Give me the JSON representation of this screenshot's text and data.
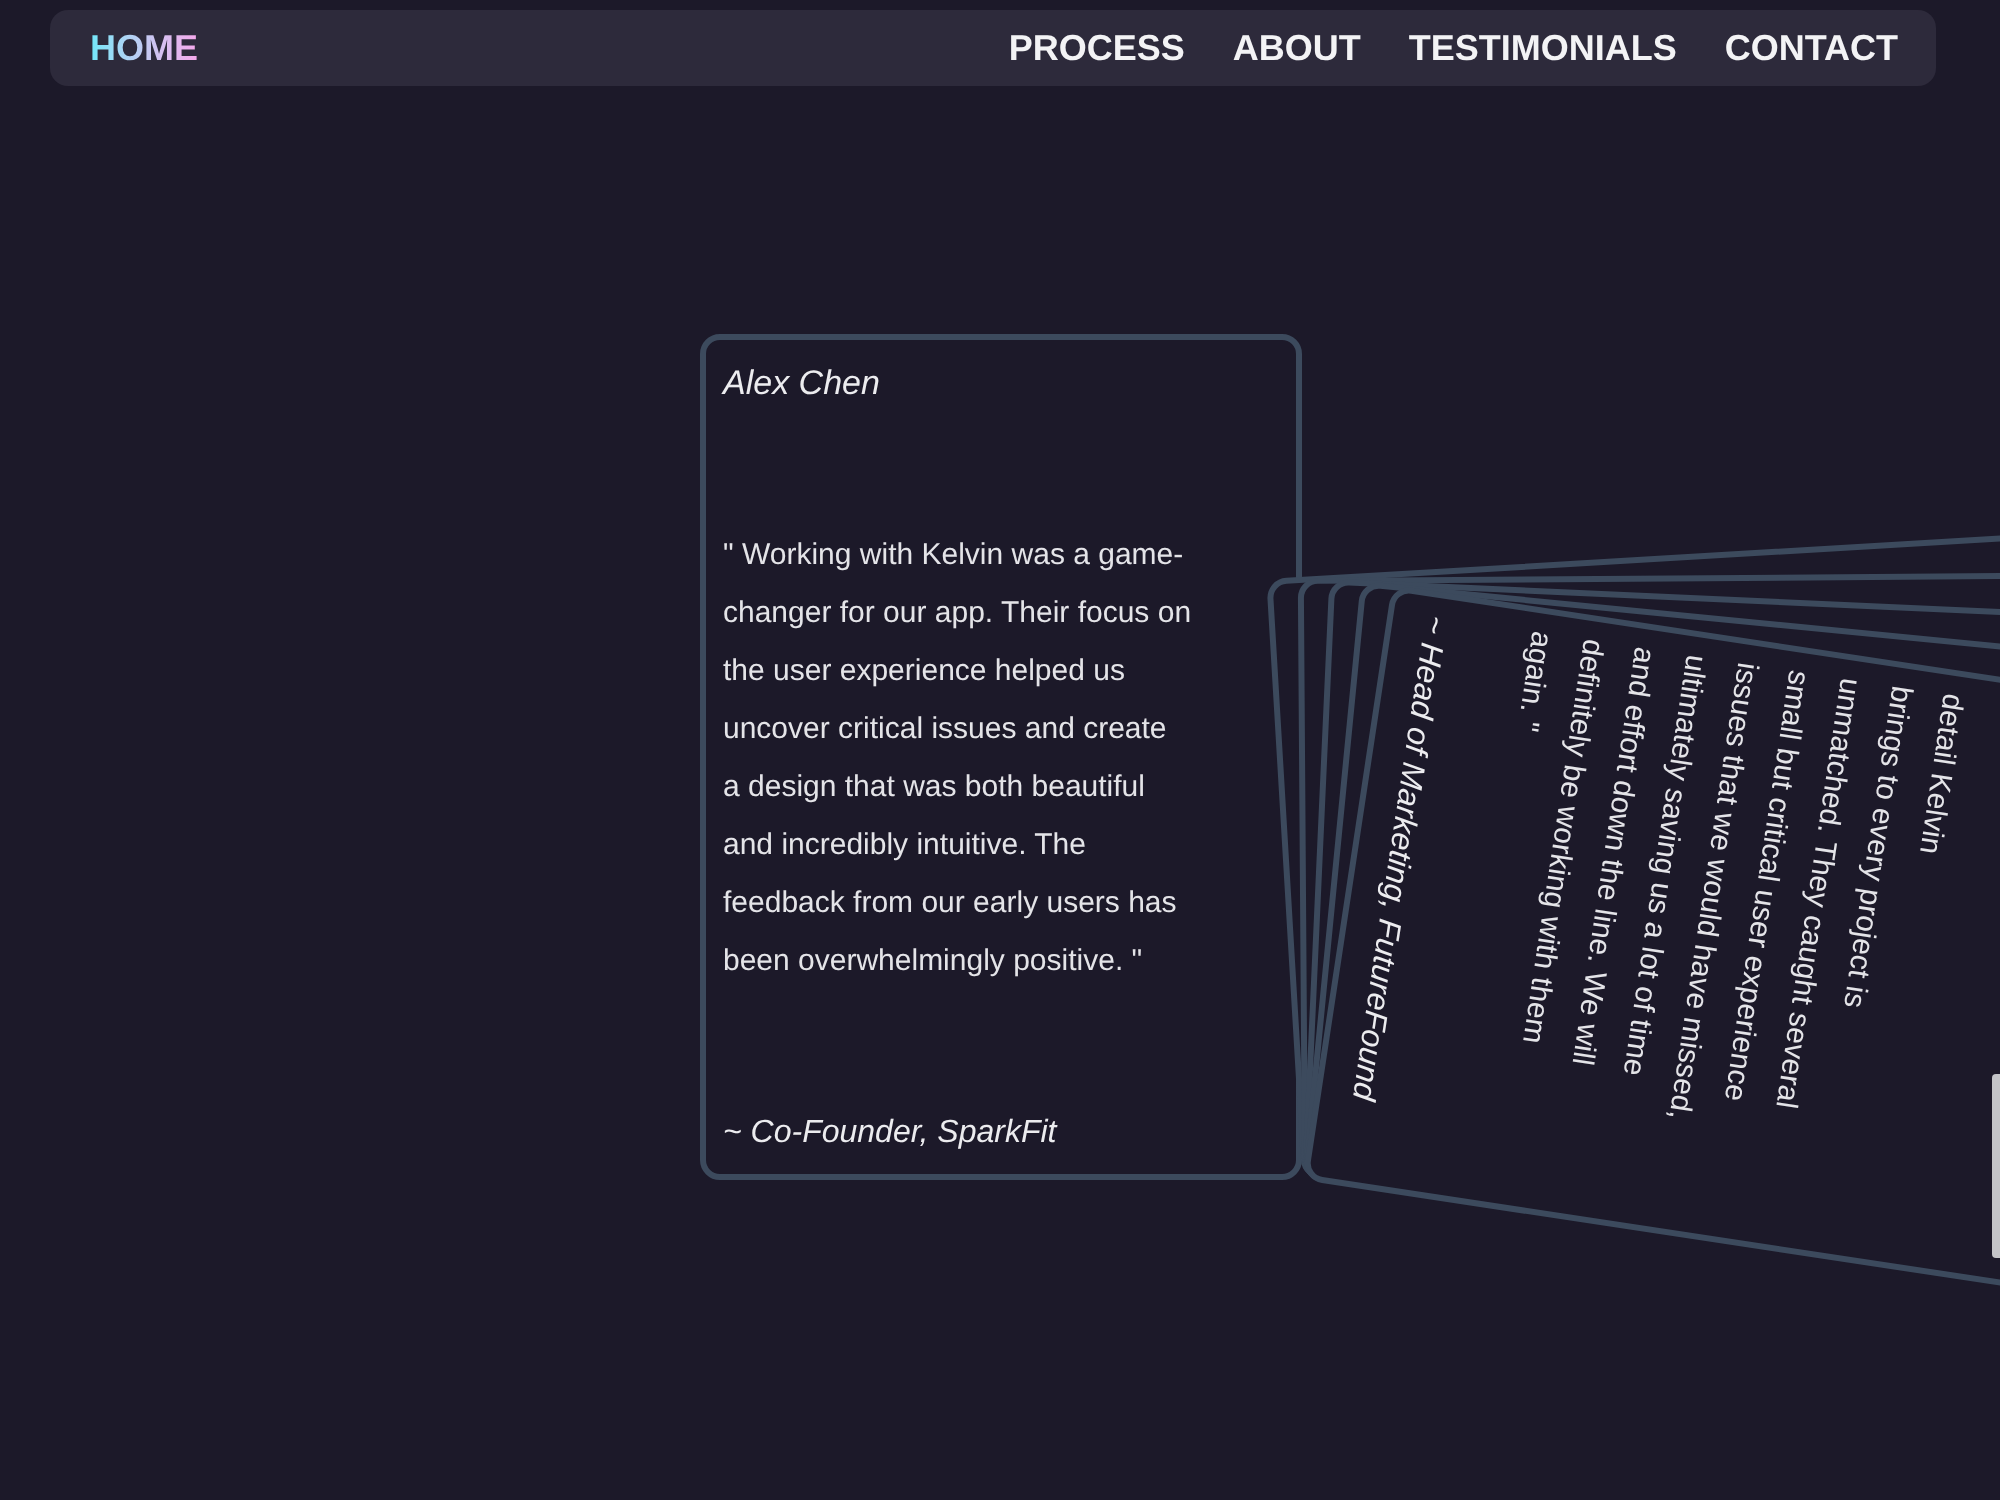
{
  "nav": {
    "items": [
      {
        "label": "HOME",
        "selected": true
      },
      {
        "label": "PROCESS",
        "selected": false
      },
      {
        "label": "ABOUT",
        "selected": false
      },
      {
        "label": "TESTIMONIALS",
        "selected": false
      },
      {
        "label": "CONTACT",
        "selected": false
      }
    ]
  },
  "testimonials": [
    {
      "kind": "upright",
      "name": "Alex Chen",
      "quote_lines": [
        "\" Working with Kelvin was a game-",
        "changer for our app. Their focus on",
        "the user experience helped us",
        "uncover critical issues and create",
        "a design that was both beautiful",
        "and incredibly intuitive. The",
        "feedback from our early users has",
        "been overwhelmingly positive. \""
      ],
      "role": "~ Co-Founder, SparkFit"
    },
    {
      "kind": "fanned"
    },
    {
      "kind": "fanned"
    },
    {
      "kind": "fanned"
    },
    {
      "kind": "fanned"
    },
    {
      "kind": "fanned",
      "quote_lines": [
        "detail Kelvin",
        "brings to every project is",
        "unmatched. They caught several",
        "small but critical user experience",
        "issues that we would have missed,",
        "ultimately saving us a lot of time",
        "and effort down the line. We will",
        "definitely be working with them",
        "again. \""
      ],
      "role": "~ Head of Marketing, FutureFound"
    }
  ]
}
